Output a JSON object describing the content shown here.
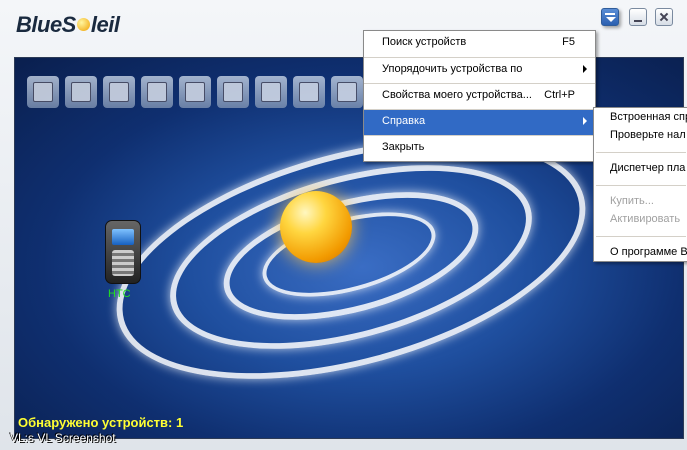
{
  "app": {
    "logo_text_left": "BlueS",
    "logo_text_right": "leil"
  },
  "window_buttons": [
    "menu-button",
    "minimize-button",
    "close-button"
  ],
  "toolbar_icons": [
    "computer-icon",
    "network-icon",
    "printer-icon",
    "file-icon",
    "pc-icon",
    "contact-card-icon",
    "fax-icon",
    "mouse-icon",
    "modem-icon"
  ],
  "device": {
    "label": "HTC"
  },
  "status": {
    "discovered": "Обнаружено устройств: 1"
  },
  "watermark": "VL:s VL Screenshot",
  "main_menu": {
    "items": [
      {
        "label": "Поиск устройств",
        "shortcut": "F5"
      },
      {
        "label": "Упорядочить устройства по",
        "shortcut": ""
      },
      {
        "label": "Свойства моего устройства...",
        "shortcut": "Ctrl+P"
      },
      {
        "label": "Справка",
        "shortcut": ""
      },
      {
        "label": "Закрыть",
        "shortcut": ""
      }
    ]
  },
  "help_submenu": {
    "items": [
      {
        "label": "Встроенная спр"
      },
      {
        "label": "Проверьте нал"
      },
      {
        "label": "Диспетчер пла"
      },
      {
        "label": "Купить..."
      },
      {
        "label": "Активировать"
      },
      {
        "label": "О программе Bl"
      }
    ]
  }
}
